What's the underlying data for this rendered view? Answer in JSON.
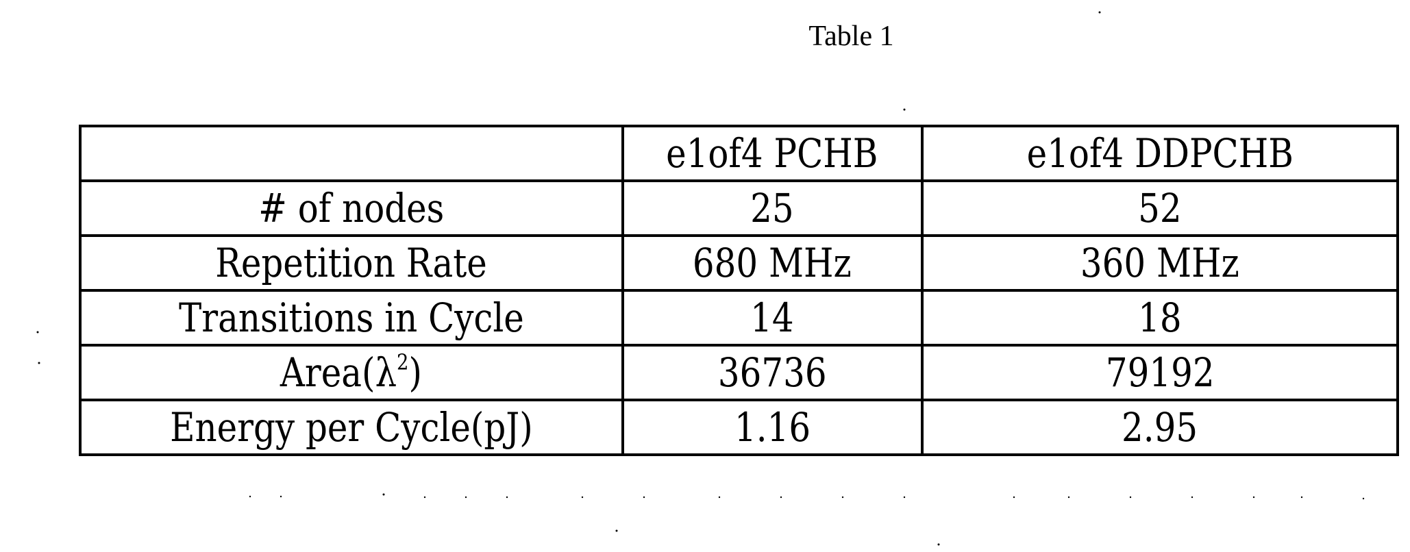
{
  "caption": "Table 1",
  "table": {
    "header": [
      "",
      "e1of4 PCHB",
      "e1of4 DDPCHB"
    ],
    "rows": [
      {
        "label": "# of nodes",
        "values": [
          "25",
          "52"
        ]
      },
      {
        "label": "Repetition Rate",
        "values": [
          "680 MHz",
          "360 MHz"
        ]
      },
      {
        "label": "Transitions in Cycle",
        "values": [
          "14",
          "18"
        ]
      },
      {
        "label_prefix": "Area(λ",
        "label_sup": "2",
        "label_suffix": ")",
        "values": [
          "36736",
          "79192"
        ]
      },
      {
        "label": "Energy per Cycle(pJ)",
        "values": [
          "1.16",
          "2.95"
        ]
      }
    ]
  }
}
